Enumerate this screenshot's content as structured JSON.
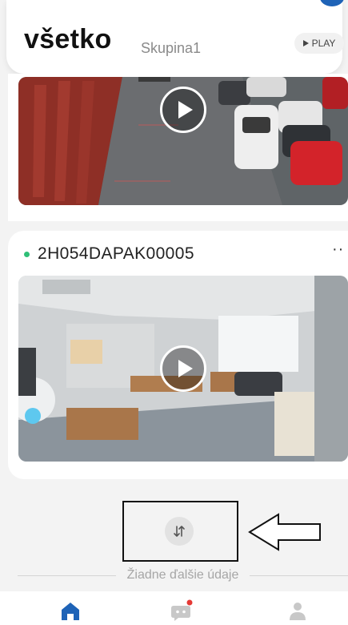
{
  "header": {
    "title": "všetko",
    "group": "Skupina1",
    "play_label": "PLAY"
  },
  "devices": [
    {
      "name": ""
    },
    {
      "name": "2H054DAPAK00005",
      "status_color": "#2fbf77",
      "more_label": "··"
    }
  ],
  "footer": {
    "no_more_text": "Žiadne ďalšie údaje"
  },
  "colors": {
    "accent": "#1e63b7",
    "online": "#2fbf77",
    "notification": "#e53935"
  },
  "icons": {
    "sort": "sort-icon",
    "home": "home-icon",
    "messages": "chat-icon",
    "profile": "person-icon"
  }
}
